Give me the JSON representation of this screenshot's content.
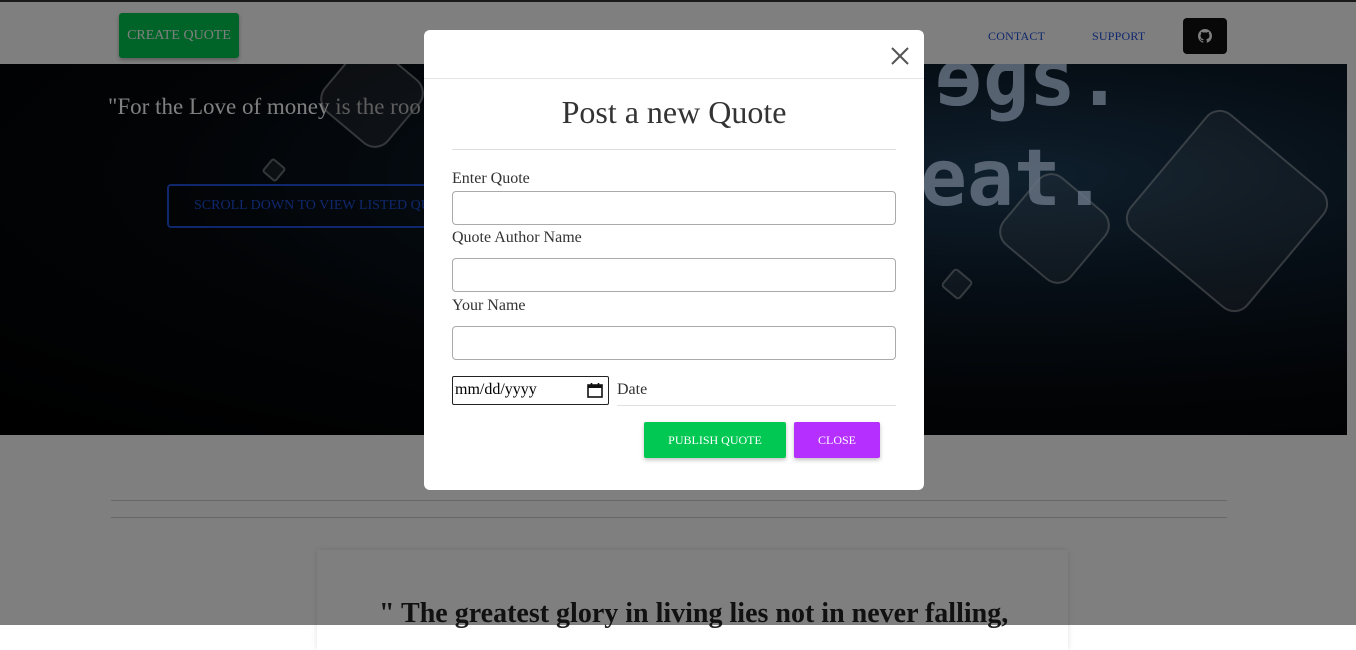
{
  "navbar": {
    "create_quote_label": "CREATE QUOTE",
    "links": [
      "CONTACT",
      "SUPPORT"
    ],
    "github_icon": "github-icon"
  },
  "hero": {
    "quote_visible": "\"For the Love of money",
    "quote_dim": " is the roo",
    "scroll_button_label": "SCROLL DOWN TO VIEW LISTED QUOTES"
  },
  "featured_quote": {
    "text": "\" The greatest glory in living lies not in never falling,"
  },
  "modal": {
    "title": "Post a new Quote",
    "close_icon": "close-icon",
    "fields": {
      "quote_label": "Enter Quote",
      "quote_value": "",
      "author_label": "Quote Author Name",
      "author_value": "",
      "your_name_label": "Your Name",
      "your_name_value": "",
      "date_placeholder": "mm/dd/yyyy",
      "date_label": "Date"
    },
    "buttons": {
      "publish": "PUBLISH QUOTE",
      "close": "CLOSE"
    }
  },
  "colors": {
    "accent_green": "#00c853",
    "accent_purple": "#b530ff",
    "link_blue": "#1e4fd8"
  }
}
